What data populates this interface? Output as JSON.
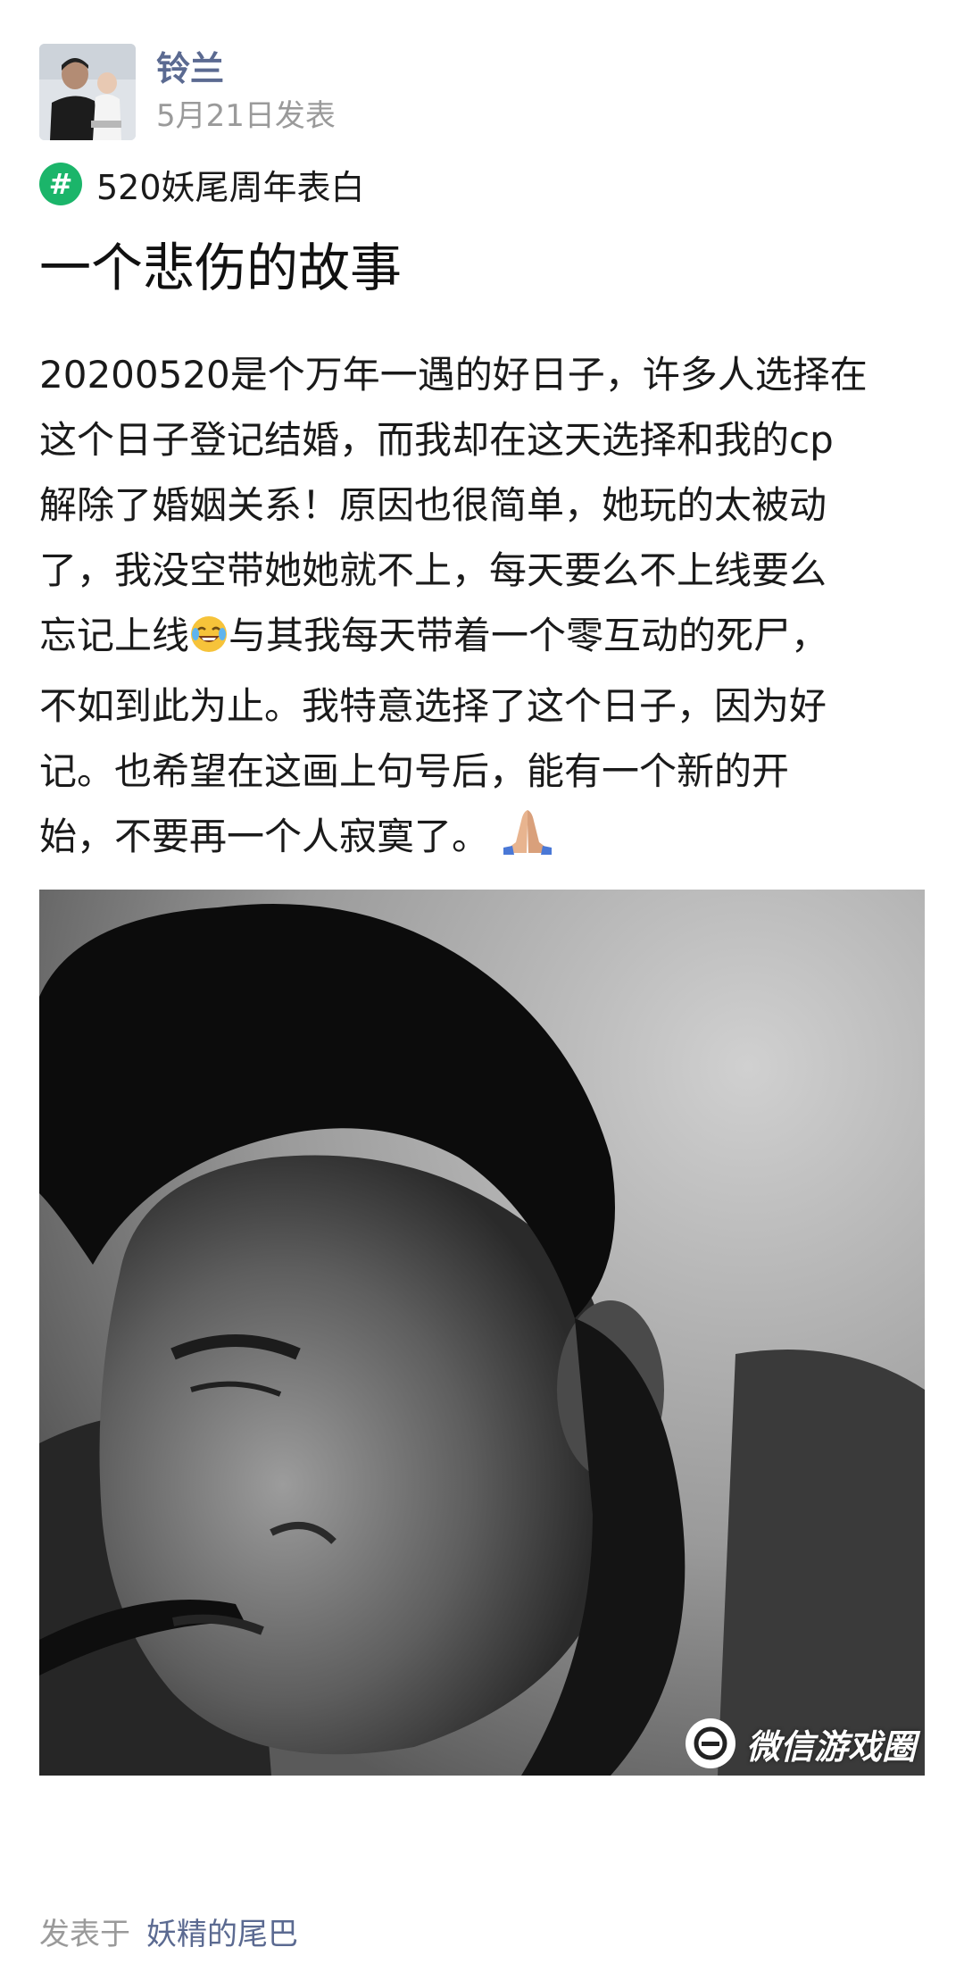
{
  "author": {
    "name": "铃兰",
    "date": "5月21日发表"
  },
  "topic": {
    "icon": "hashtag-icon",
    "label": "520妖尾周年表白"
  },
  "post": {
    "title": "一个悲伤的故事",
    "body_lines": [
      "20200520是个万年一遇的好日子，许多人选择在",
      "这个日子登记结婚，而我却在这天选择和我的cp",
      "解除了婚姻关系！原因也很简单，她玩的太被动",
      "了，我没空带她她就不上，每天要么不上线要么",
      "忘记上线",
      "与其我每天带着一个零互动的死尸，",
      "不如到此为止。我特意选择了这个日子，因为好",
      "记。也希望在这画上句号后，能有一个新的开",
      "始，不要再一个人寂寞了。"
    ]
  },
  "image": {
    "watermark": "微信游戏圈"
  },
  "footer": {
    "prefix": "发表于",
    "link": "妖精的尾巴"
  },
  "colors": {
    "accent": "#5b6a91",
    "topic_green": "#1bb56a",
    "muted": "#9a9a9a"
  }
}
